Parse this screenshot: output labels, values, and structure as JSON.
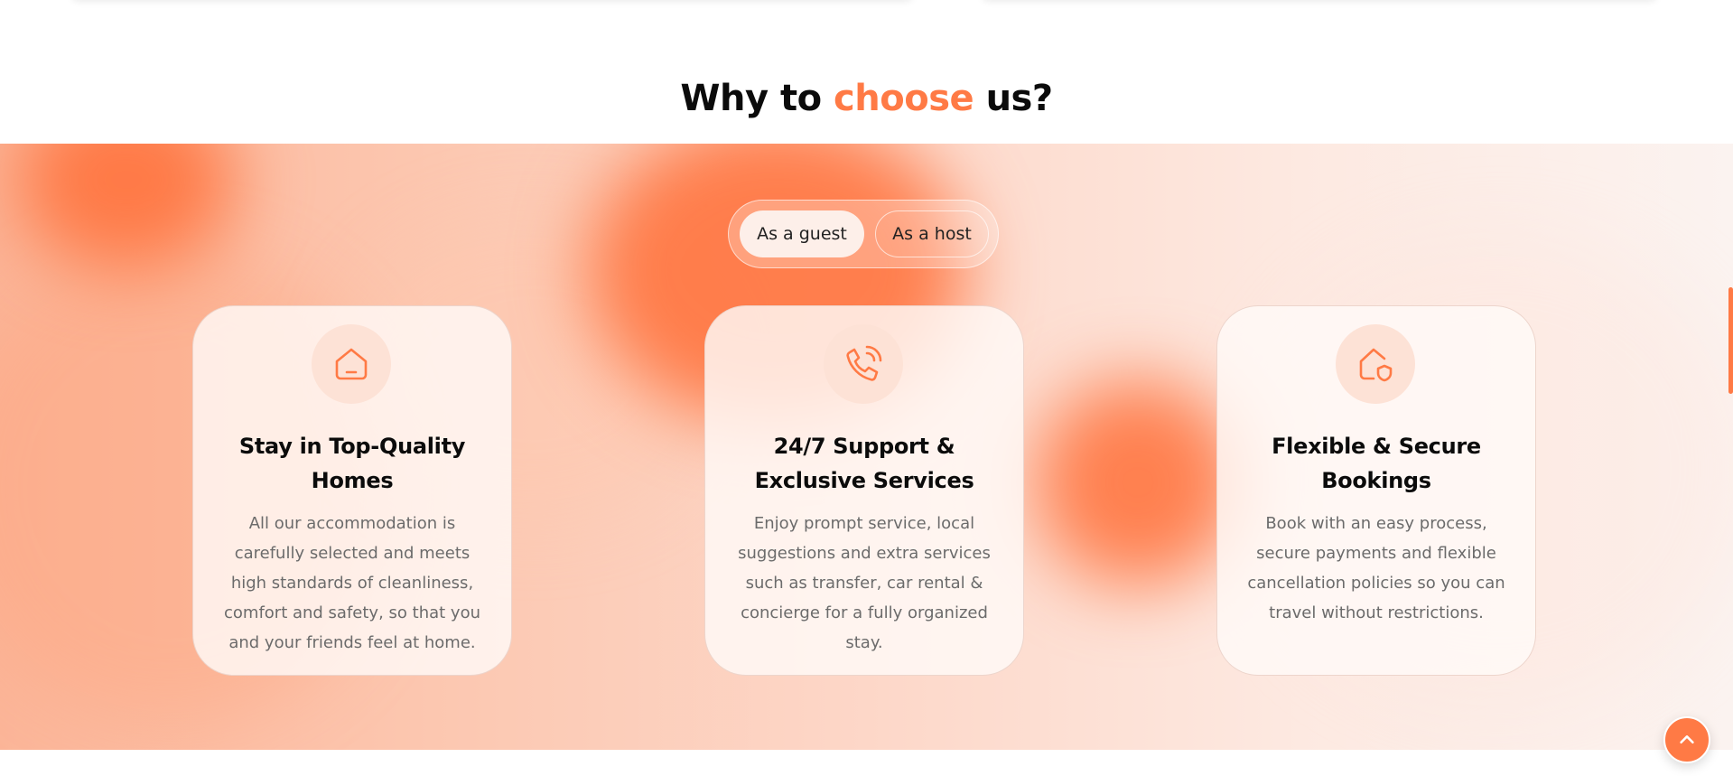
{
  "section": {
    "title_prefix": "Why to ",
    "title_accent": "choose",
    "title_suffix": " us?"
  },
  "toggle": {
    "guest_label": "As a guest",
    "host_label": "As a host",
    "active": "guest"
  },
  "cards": [
    {
      "icon": "home-icon",
      "title": "Stay in Top-Quality Homes",
      "text": "All our accommodation is carefully selected and meets high standards of cleanliness, comfort and safety, so that you and your friends feel at home."
    },
    {
      "icon": "phone-call-icon",
      "title": "24/7 Support & Exclusive Services",
      "text": "Enjoy prompt service, local suggestions and extra services such as transfer, car rental & concierge for a fully organized stay."
    },
    {
      "icon": "home-shield-icon",
      "title": "Flexible & Secure Bookings",
      "text": "Book with an easy process, secure payments and flexible cancellation policies so you can travel without restrictions."
    }
  ],
  "colors": {
    "accent": "#ff7a45",
    "icon_bg": "#fde2d6",
    "heading": "#0b0b0b",
    "body_text": "#6b6b6b"
  },
  "scroll_top": {
    "icon": "chevron-up-icon"
  }
}
